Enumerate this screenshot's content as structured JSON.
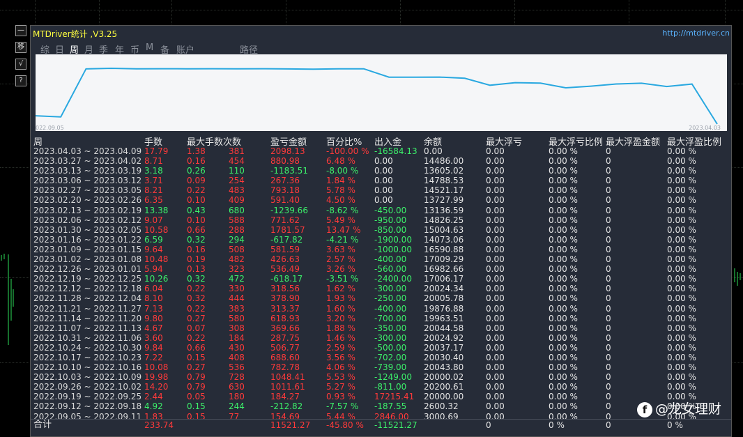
{
  "window": {
    "title": "MTDriver统计 ,V3.25",
    "url": "http://mtdriver.cn"
  },
  "side_buttons": [
    "—",
    "移",
    "√",
    "?"
  ],
  "tabs": [
    "综",
    "日",
    "周",
    "月",
    "季",
    "年",
    "币",
    "M",
    "备",
    "账户",
    "路径"
  ],
  "active_tab": 2,
  "chart": {
    "start_date": "022.09.05",
    "end_date": "2023.04.03",
    "line_color": "#29a8e0",
    "balance_series": [
      3000.69,
      2600.32,
      20000.0,
      20200.61,
      20000.02,
      20043.8,
      20030.4,
      20037.17,
      20024.92,
      20044.58,
      19963.51,
      19876.88,
      20005.78,
      20024.34,
      17006.17,
      16982.66,
      17009.29,
      16590.88,
      14073.06,
      15004.63,
      14826.25,
      13136.59,
      13727.99,
      14521.17,
      14788.53,
      13605.02,
      14486.0,
      0.0
    ]
  },
  "headers": [
    "周",
    "手数",
    "最大手数",
    "次数",
    "盈亏金额",
    "百分比%",
    "出入金",
    "余额",
    "最大浮亏",
    "最大浮亏比例",
    "最大浮盈金额",
    "最大浮盈比例"
  ],
  "rows": [
    {
      "period": "2023.04.03 ~ 2023.04.09",
      "lots": "17.79",
      "maxlots": "1.38",
      "count": "381",
      "pl": "2098.13",
      "pct": "-100.00 %",
      "flow": "-16584.13",
      "bal": "0.00",
      "mfl": "0.00",
      "mflp": "0.00 %",
      "mfp": "0",
      "mfpp": "0.00 %",
      "c": "red",
      "fc": "green"
    },
    {
      "period": "2023.03.27 ~ 2023.04.02",
      "lots": "8.71",
      "maxlots": "0.16",
      "count": "454",
      "pl": "880.98",
      "pct": "6.48 %",
      "flow": "0.00",
      "bal": "14486.00",
      "mfl": "0.00",
      "mflp": "0.00 %",
      "mfp": "0",
      "mfpp": "0.00 %",
      "c": "red",
      "fc": "white"
    },
    {
      "period": "2023.03.13 ~ 2023.03.19",
      "lots": "3.18",
      "maxlots": "0.26",
      "count": "110",
      "pl": "-1183.51",
      "pct": "-8.00 %",
      "flow": "0.00",
      "bal": "13605.02",
      "mfl": "0.00",
      "mflp": "0.00 %",
      "mfp": "0",
      "mfpp": "0.00 %",
      "c": "green",
      "fc": "white"
    },
    {
      "period": "2023.03.06 ~ 2023.03.12",
      "lots": "3.71",
      "maxlots": "0.09",
      "count": "254",
      "pl": "267.36",
      "pct": "1.84 %",
      "flow": "0.00",
      "bal": "14788.53",
      "mfl": "0.00",
      "mflp": "0.00 %",
      "mfp": "0",
      "mfpp": "0.00 %",
      "c": "red",
      "fc": "white"
    },
    {
      "period": "2023.02.27 ~ 2023.03.05",
      "lots": "8.21",
      "maxlots": "0.22",
      "count": "483",
      "pl": "793.18",
      "pct": "5.78 %",
      "flow": "0.00",
      "bal": "14521.17",
      "mfl": "0.00",
      "mflp": "0.00 %",
      "mfp": "0",
      "mfpp": "0.00 %",
      "c": "red",
      "fc": "white"
    },
    {
      "period": "2023.02.20 ~ 2023.02.26",
      "lots": "6.35",
      "maxlots": "0.10",
      "count": "409",
      "pl": "591.40",
      "pct": "4.50 %",
      "flow": "0.00",
      "bal": "13727.99",
      "mfl": "0.00",
      "mflp": "0.00 %",
      "mfp": "0",
      "mfpp": "0.00 %",
      "c": "red",
      "fc": "white"
    },
    {
      "period": "2023.02.13 ~ 2023.02.19",
      "lots": "13.38",
      "maxlots": "0.43",
      "count": "680",
      "pl": "-1239.66",
      "pct": "-8.62 %",
      "flow": "-450.00",
      "bal": "13136.59",
      "mfl": "0.00",
      "mflp": "0.00 %",
      "mfp": "0",
      "mfpp": "0.00 %",
      "c": "green",
      "fc": "green"
    },
    {
      "period": "2023.02.06 ~ 2023.02.12",
      "lots": "9.07",
      "maxlots": "0.10",
      "count": "588",
      "pl": "771.62",
      "pct": "5.49 %",
      "flow": "-950.00",
      "bal": "14826.25",
      "mfl": "0.00",
      "mflp": "0.00 %",
      "mfp": "0",
      "mfpp": "0.00 %",
      "c": "red",
      "fc": "green"
    },
    {
      "period": "2023.01.30 ~ 2023.02.05",
      "lots": "10.58",
      "maxlots": "0.66",
      "count": "288",
      "pl": "1781.57",
      "pct": "13.47 %",
      "flow": "-850.00",
      "bal": "15004.63",
      "mfl": "0.00",
      "mflp": "0.00 %",
      "mfp": "0",
      "mfpp": "0.00 %",
      "c": "red",
      "fc": "green"
    },
    {
      "period": "2023.01.16 ~ 2023.01.22",
      "lots": "6.59",
      "maxlots": "0.32",
      "count": "294",
      "pl": "-617.82",
      "pct": "-4.21 %",
      "flow": "-1900.00",
      "bal": "14073.06",
      "mfl": "0.00",
      "mflp": "0.00 %",
      "mfp": "0",
      "mfpp": "0.00 %",
      "c": "green",
      "fc": "green"
    },
    {
      "period": "2023.01.09 ~ 2023.01.15",
      "lots": "9.64",
      "maxlots": "0.16",
      "count": "508",
      "pl": "581.59",
      "pct": "3.63 %",
      "flow": "-1000.00",
      "bal": "16590.88",
      "mfl": "0.00",
      "mflp": "0.00 %",
      "mfp": "0",
      "mfpp": "0.00 %",
      "c": "red",
      "fc": "green"
    },
    {
      "period": "2023.01.02 ~ 2023.01.08",
      "lots": "10.48",
      "maxlots": "0.19",
      "count": "482",
      "pl": "426.63",
      "pct": "2.57 %",
      "flow": "-400.00",
      "bal": "17009.29",
      "mfl": "0.00",
      "mflp": "0.00 %",
      "mfp": "0",
      "mfpp": "0.00 %",
      "c": "red",
      "fc": "green"
    },
    {
      "period": "2022.12.26 ~ 2023.01.01",
      "lots": "5.94",
      "maxlots": "0.13",
      "count": "323",
      "pl": "536.49",
      "pct": "3.26 %",
      "flow": "-560.00",
      "bal": "16982.66",
      "mfl": "0.00",
      "mflp": "0.00 %",
      "mfp": "0",
      "mfpp": "0.00 %",
      "c": "red",
      "fc": "green"
    },
    {
      "period": "2022.12.19 ~ 2022.12.25",
      "lots": "10.26",
      "maxlots": "0.32",
      "count": "472",
      "pl": "-618.17",
      "pct": "-3.51 %",
      "flow": "-2400.00",
      "bal": "17006.17",
      "mfl": "0.00",
      "mflp": "0.00 %",
      "mfp": "0",
      "mfpp": "0.00 %",
      "c": "green",
      "fc": "green"
    },
    {
      "period": "2022.12.12 ~ 2022.12.18",
      "lots": "6.04",
      "maxlots": "0.22",
      "count": "330",
      "pl": "318.56",
      "pct": "1.62 %",
      "flow": "-300.00",
      "bal": "20024.34",
      "mfl": "0.00",
      "mflp": "0.00 %",
      "mfp": "0",
      "mfpp": "0.00 %",
      "c": "red",
      "fc": "green"
    },
    {
      "period": "2022.11.28 ~ 2022.12.04",
      "lots": "8.10",
      "maxlots": "0.32",
      "count": "444",
      "pl": "378.90",
      "pct": "1.93 %",
      "flow": "-250.00",
      "bal": "20005.78",
      "mfl": "0.00",
      "mflp": "0.00 %",
      "mfp": "0",
      "mfpp": "0.00 %",
      "c": "red",
      "fc": "green"
    },
    {
      "period": "2022.11.21 ~ 2022.11.27",
      "lots": "7.13",
      "maxlots": "0.22",
      "count": "383",
      "pl": "313.37",
      "pct": "1.60 %",
      "flow": "-400.00",
      "bal": "19876.88",
      "mfl": "0.00",
      "mflp": "0.00 %",
      "mfp": "0",
      "mfpp": "0.00 %",
      "c": "red",
      "fc": "green"
    },
    {
      "period": "2022.11.14 ~ 2022.11.20",
      "lots": "9.80",
      "maxlots": "0.27",
      "count": "580",
      "pl": "618.93",
      "pct": "3.20 %",
      "flow": "-700.00",
      "bal": "19963.51",
      "mfl": "0.00",
      "mflp": "0.00 %",
      "mfp": "0",
      "mfpp": "0.00 %",
      "c": "red",
      "fc": "green"
    },
    {
      "period": "2022.11.07 ~ 2022.11.13",
      "lots": "4.67",
      "maxlots": "0.07",
      "count": "308",
      "pl": "369.66",
      "pct": "1.88 %",
      "flow": "-350.00",
      "bal": "20044.58",
      "mfl": "0.00",
      "mflp": "0.00 %",
      "mfp": "0",
      "mfpp": "0.00 %",
      "c": "red",
      "fc": "green"
    },
    {
      "period": "2022.10.31 ~ 2022.11.06",
      "lots": "3.60",
      "maxlots": "0.22",
      "count": "184",
      "pl": "287.75",
      "pct": "1.46 %",
      "flow": "-300.00",
      "bal": "20024.92",
      "mfl": "0.00",
      "mflp": "0.00 %",
      "mfp": "0",
      "mfpp": "0.00 %",
      "c": "red",
      "fc": "green"
    },
    {
      "period": "2022.10.24 ~ 2022.10.30",
      "lots": "9.84",
      "maxlots": "0.66",
      "count": "430",
      "pl": "506.77",
      "pct": "2.59 %",
      "flow": "-500.00",
      "bal": "20037.17",
      "mfl": "0.00",
      "mflp": "0.00 %",
      "mfp": "0",
      "mfpp": "0.00 %",
      "c": "red",
      "fc": "green"
    },
    {
      "period": "2022.10.17 ~ 2022.10.23",
      "lots": "7.22",
      "maxlots": "0.15",
      "count": "408",
      "pl": "688.60",
      "pct": "3.56 %",
      "flow": "-702.00",
      "bal": "20030.40",
      "mfl": "0.00",
      "mflp": "0.00 %",
      "mfp": "0",
      "mfpp": "0.00 %",
      "c": "red",
      "fc": "green"
    },
    {
      "period": "2022.10.10 ~ 2022.10.16",
      "lots": "10.08",
      "maxlots": "0.27",
      "count": "536",
      "pl": "782.78",
      "pct": "4.06 %",
      "flow": "-739.00",
      "bal": "20043.80",
      "mfl": "0.00",
      "mflp": "0.00 %",
      "mfp": "0",
      "mfpp": "0.00 %",
      "c": "red",
      "fc": "green"
    },
    {
      "period": "2022.10.03 ~ 2022.10.09",
      "lots": "19.98",
      "maxlots": "0.79",
      "count": "728",
      "pl": "1048.41",
      "pct": "5.53 %",
      "flow": "-1249.00",
      "bal": "20000.02",
      "mfl": "0.00",
      "mflp": "0.00 %",
      "mfp": "0",
      "mfpp": "0.00 %",
      "c": "red",
      "fc": "green"
    },
    {
      "period": "2022.09.26 ~ 2022.10.02",
      "lots": "14.20",
      "maxlots": "0.79",
      "count": "630",
      "pl": "1011.61",
      "pct": "5.27 %",
      "flow": "-811.00",
      "bal": "20200.61",
      "mfl": "0.00",
      "mflp": "0.00 %",
      "mfp": "0",
      "mfpp": "0.00 %",
      "c": "red",
      "fc": "green"
    },
    {
      "period": "2022.09.19 ~ 2022.09.25",
      "lots": "2.44",
      "maxlots": "0.05",
      "count": "180",
      "pl": "184.27",
      "pct": "0.93 %",
      "flow": "17215.41",
      "bal": "20000.00",
      "mfl": "0.00",
      "mflp": "0.00 %",
      "mfp": "0",
      "mfpp": "0.00 %",
      "c": "red",
      "fc": "red"
    },
    {
      "period": "2022.09.12 ~ 2022.09.18",
      "lots": "4.92",
      "maxlots": "0.15",
      "count": "244",
      "pl": "-212.82",
      "pct": "-7.57 %",
      "flow": "-187.55",
      "bal": "2600.32",
      "mfl": "0.00",
      "mflp": "0.00 %",
      "mfp": "0",
      "mfpp": "0.00 %",
      "c": "green",
      "fc": "green"
    },
    {
      "period": "2022.09.05 ~ 2022.09.11",
      "lots": "1.83",
      "maxlots": "0.15",
      "count": "77",
      "pl": "154.69",
      "pct": "5.44 %",
      "flow": "2846.00",
      "bal": "3000.69",
      "mfl": "0.00",
      "mflp": "0.00 %",
      "mfp": "0",
      "mfpp": "0.00 %",
      "c": "red",
      "fc": "red"
    }
  ],
  "total": {
    "label": "合计",
    "lots": "233.74",
    "pl": "11521.27",
    "pct": "-45.80 %",
    "flow": "-11521.27",
    "mfl": "0",
    "mflp": "0 %",
    "mfp": "0",
    "mfpp": "0 %"
  },
  "watermark": {
    "icon": "face-icon",
    "text": "@龙女理财"
  }
}
